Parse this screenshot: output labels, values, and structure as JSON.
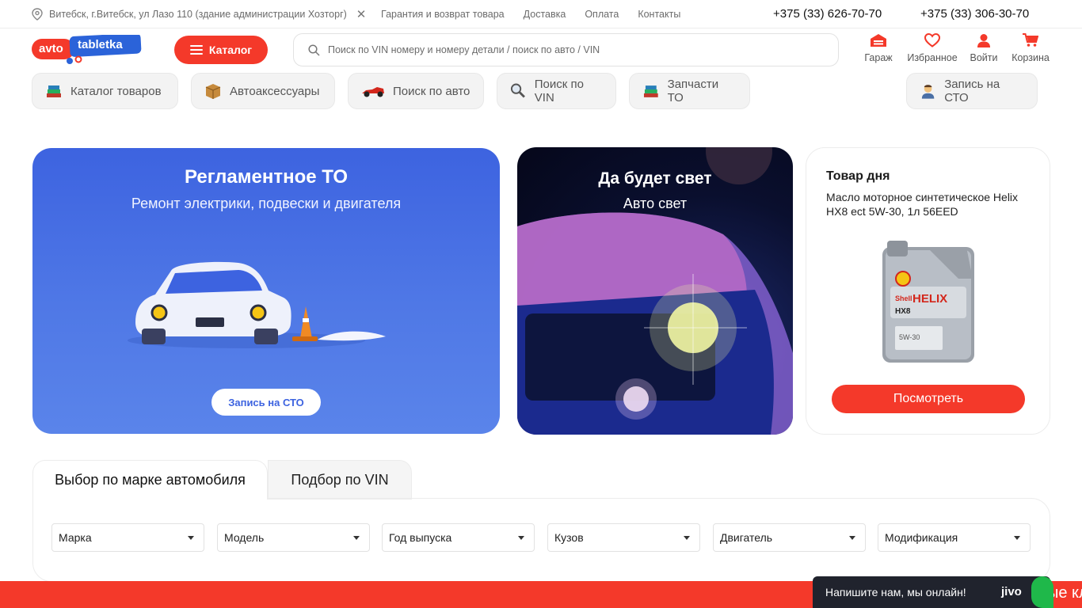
{
  "topbar": {
    "location": "Витебск, г.Витебск, ул Лазо 110 (здание администрации Хозторг)",
    "links": [
      "Гарантия и возврат товара",
      "Доставка",
      "Оплата",
      "Контакты"
    ],
    "phones": [
      "+375 (33) 626-70-70",
      "+375 (33) 306-30-70"
    ]
  },
  "header": {
    "logo_left": "avto",
    "logo_right": "tabletka",
    "catalog_label": "Каталог",
    "search_placeholder": "Поиск по VIN номеру и номеру детали / поиск по авто / VIN",
    "icons": [
      {
        "label": "Гараж",
        "icon": "garage-icon"
      },
      {
        "label": "Избранное",
        "icon": "heart-icon"
      },
      {
        "label": "Войти",
        "icon": "user-icon"
      },
      {
        "label": "Корзина",
        "icon": "cart-icon"
      }
    ]
  },
  "quicknav": [
    {
      "label": "Каталог товаров",
      "icon": "books-icon"
    },
    {
      "label": "Автоаксессуары",
      "icon": "box-icon"
    },
    {
      "label": "Поиск по авто",
      "icon": "racecar-icon"
    },
    {
      "label": "Поиск по VIN",
      "icon": "magnifier-icon"
    },
    {
      "label": "Запчасти ТО",
      "icon": "books-icon"
    },
    {
      "label": "Запись на СТО",
      "icon": "mechanic-icon"
    }
  ],
  "banners": {
    "service": {
      "title": "Регламентное ТО",
      "subtitle": "Ремонт электрики, подвески и двигателя",
      "button": "Запись на СТО"
    },
    "light": {
      "title": "Да будет свет",
      "subtitle": "Авто свет"
    }
  },
  "product_of_day": {
    "heading": "Товар дня",
    "name": "Масло моторное синтетическое Helix HX8 ect 5W-30, 1л 56EED",
    "button": "Посмотреть",
    "bottle_brand": "Shell",
    "bottle_line": "HELIX",
    "bottle_model": "HX8",
    "bottle_grade": "5W-30"
  },
  "car_selector": {
    "tabs": [
      "Выбор по марке автомобиля",
      "Подбор по VIN"
    ],
    "selects": [
      "Марка",
      "Модель",
      "Год выпуска",
      "Кузов",
      "Двигатель",
      "Модификация"
    ]
  },
  "footer_marquee": "ые кл",
  "chat": {
    "text": "Напишите нам, мы онлайн!",
    "brand": "jivo"
  },
  "colors": {
    "accent": "#f4392a",
    "banner_blue": "#3d63e0",
    "chat_bg": "#20232d"
  }
}
